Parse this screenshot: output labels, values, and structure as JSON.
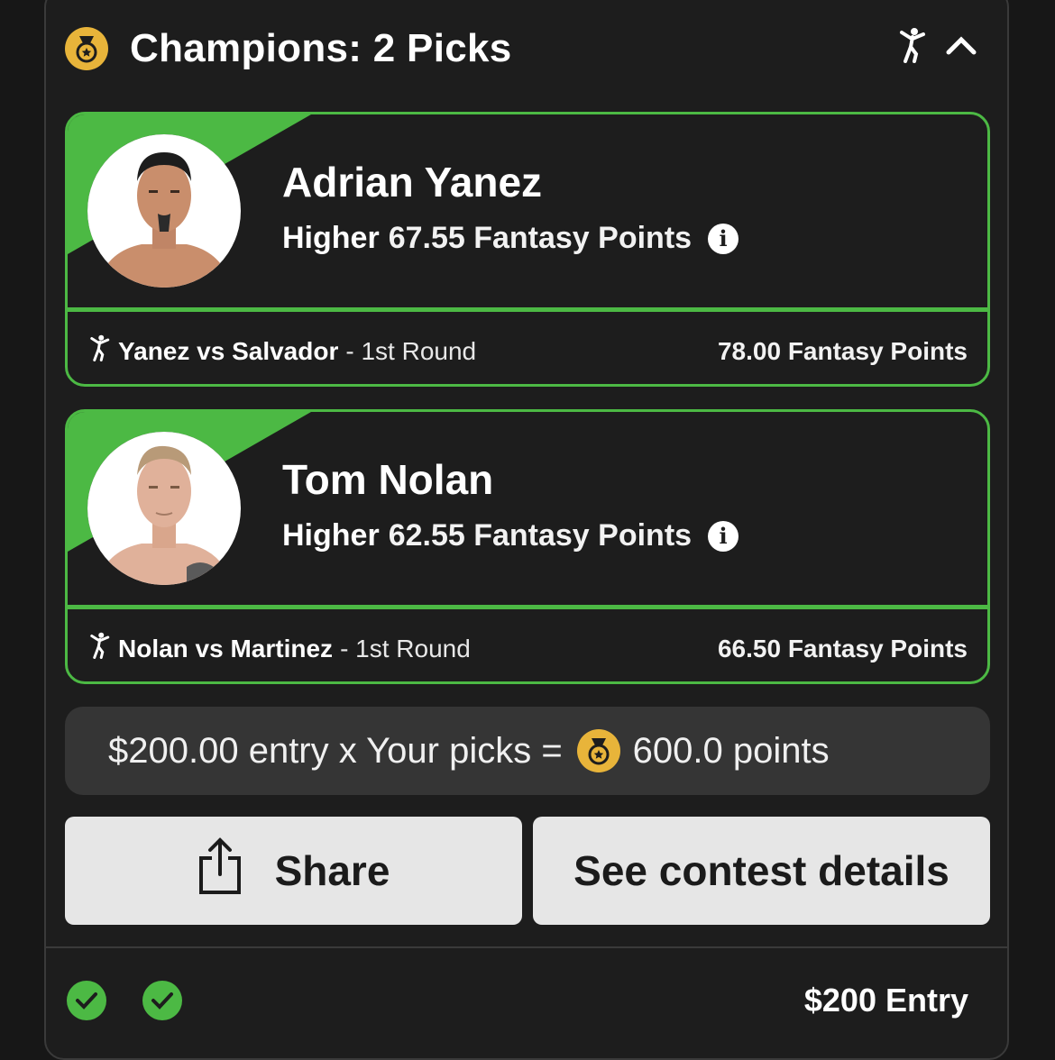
{
  "header": {
    "title": "Champions: 2 Picks",
    "icons": [
      "medal-icon",
      "fighter-icon",
      "chevron-up-icon"
    ]
  },
  "picks": [
    {
      "player": "Adrian Yanez",
      "direction": "Higher",
      "line": "67.55 Fantasy Points",
      "matchup": "Yanez vs Salvador",
      "round": "- 1st Round",
      "result": "78.00 Fantasy Points",
      "status": "won"
    },
    {
      "player": "Tom Nolan",
      "direction": "Higher",
      "line": "62.55 Fantasy Points",
      "matchup": "Nolan vs Martinez",
      "round": "- 1st Round",
      "result": "66.50 Fantasy Points",
      "status": "won"
    }
  ],
  "payout": {
    "prefix": "$200.00 entry x Your picks =",
    "points": "600.0 points"
  },
  "buttons": {
    "share": "Share",
    "details": "See contest details"
  },
  "footer": {
    "entry": "$200 Entry",
    "check_count": 2
  },
  "colors": {
    "accent_green": "#4cb944",
    "medal_gold": "#e8b43a",
    "background": "#1d1d1d"
  }
}
